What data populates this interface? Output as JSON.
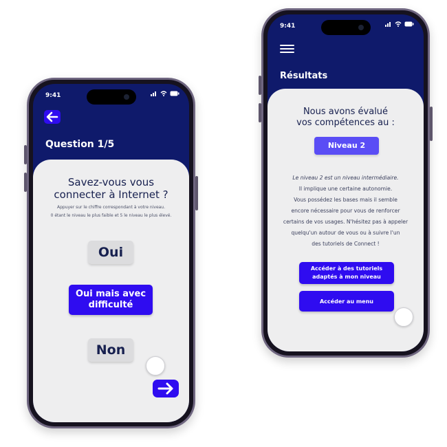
{
  "phone_left": {
    "status": {
      "time": "9:41",
      "icons": "▐▌ ◠ ▭"
    },
    "header": {
      "back_icon": "arrow-left-icon",
      "title": "Question 1/5"
    },
    "question": {
      "title": "Savez-vous vous connecter à Internet ?",
      "instruction_line1": "Appuyer sur le chiffre correspondant à votre niveau.",
      "instruction_line2": "0 étant le niveau le plus faible et 5 le niveau le plus élevé."
    },
    "options": [
      {
        "label": "Oui"
      },
      {
        "label": "Oui mais avec difficulté"
      },
      {
        "label": "Non"
      }
    ],
    "next_icon": "arrow-right-icon"
  },
  "phone_right": {
    "status": {
      "time": "9:41",
      "icons": "▐▌ ◠ ▭"
    },
    "header": {
      "menu_icon": "hamburger-menu-icon",
      "title": "Résultats"
    },
    "result": {
      "heading_line1": "Nous avons évalué",
      "heading_line2": "vos compétences au :",
      "level_badge": "Niveau 2",
      "paragraph": [
        "Le niveau 2 est un niveau intermédiaire.",
        "Il implique une certaine autonomie.",
        "Vous possédez les bases mais il semble",
        "encore nécessaire pour vous de renforcer",
        "certains de vos usages. N'hésitez pas à appeler",
        "quelqu'un autour de vous ou à suivre l'un",
        "des tutoriels de Connect !"
      ]
    },
    "buttons": {
      "tutorials_line1": "Accéder à des tutoriels",
      "tutorials_line2": "adaptés à mon niveau",
      "menu": "Accéder au menu"
    }
  },
  "colors": {
    "header_navy": "#0f1a6b",
    "accent_blue": "#2f0cf0",
    "badge_blue": "#5a4df5",
    "card_grey": "#eeeeef"
  }
}
